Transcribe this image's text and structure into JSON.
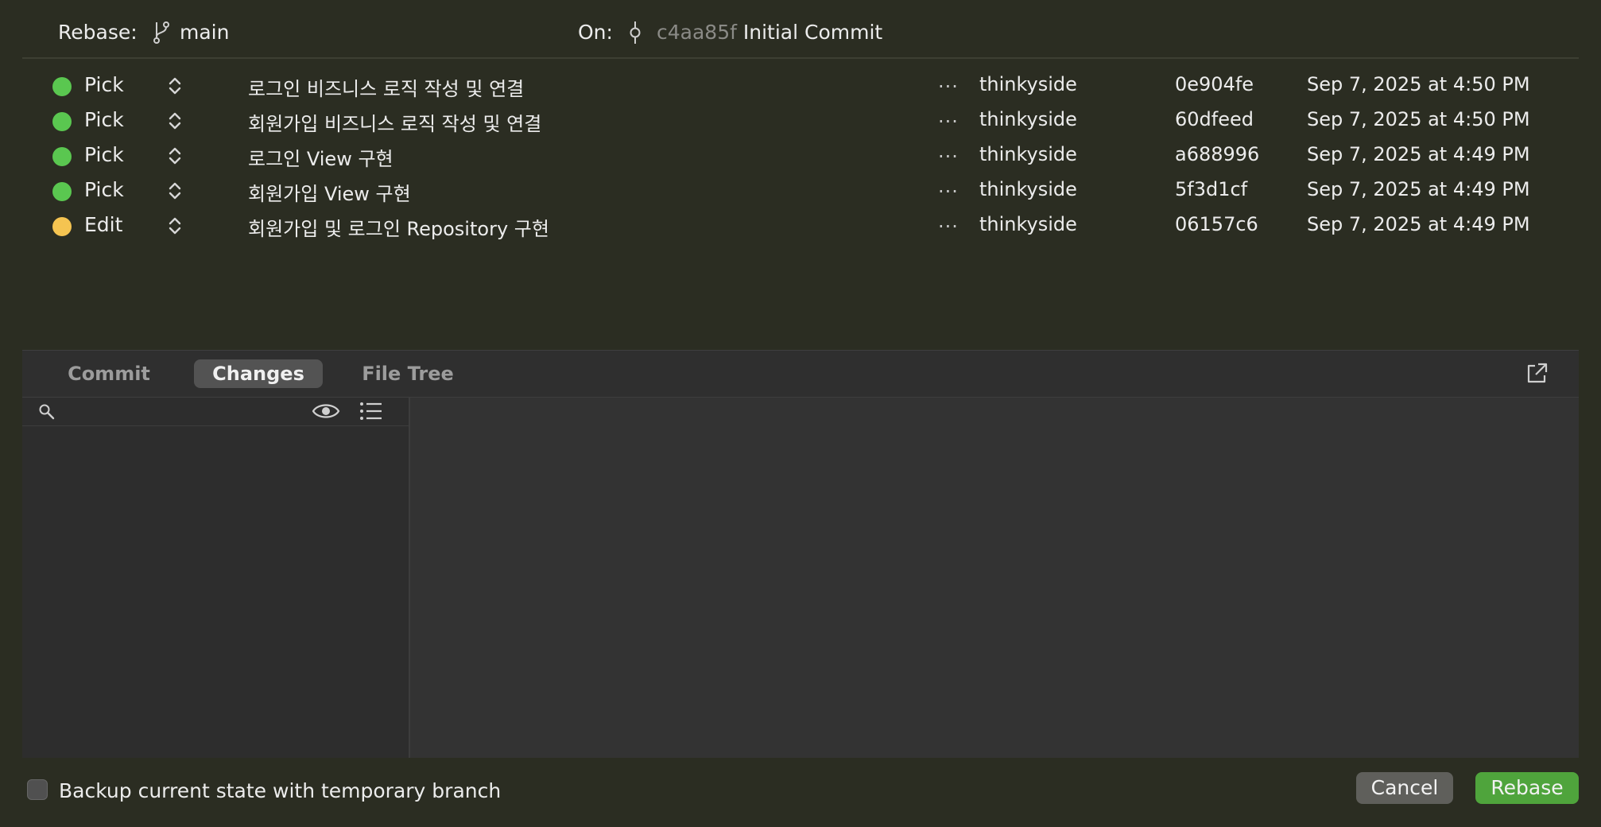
{
  "header": {
    "rebase_label": "Rebase:",
    "branch_icon": "branch-icon",
    "branch_name": "main",
    "on_label": "On:",
    "commit_icon": "commit-icon",
    "onto_hash": "c4aa85f",
    "onto_message": "Initial Commit"
  },
  "rows": [
    {
      "action": "Pick",
      "status_color": "#5ac750",
      "message": "로그인 비즈니스 로직 작성 및 연결",
      "more": "...",
      "author": "thinkyside",
      "hash": "0e904fe",
      "date": "Sep 7, 2025 at 4:50 PM"
    },
    {
      "action": "Pick",
      "status_color": "#5ac750",
      "message": "회원가입 비즈니스 로직 작성 및 연결",
      "more": "...",
      "author": "thinkyside",
      "hash": "60dfeed",
      "date": "Sep 7, 2025 at 4:50 PM"
    },
    {
      "action": "Pick",
      "status_color": "#5ac750",
      "message": "로그인 View 구현",
      "more": "...",
      "author": "thinkyside",
      "hash": "a688996",
      "date": "Sep 7, 2025 at 4:49 PM"
    },
    {
      "action": "Pick",
      "status_color": "#5ac750",
      "message": "회원가입 View 구현",
      "more": "...",
      "author": "thinkyside",
      "hash": "5f3d1cf",
      "date": "Sep 7, 2025 at 4:49 PM"
    },
    {
      "action": "Edit",
      "status_color": "#f5c451",
      "message": "회원가입 및 로그인 Repository 구현",
      "more": "...",
      "author": "thinkyside",
      "hash": "06157c6",
      "date": "Sep 7, 2025 at 4:49 PM"
    }
  ],
  "tabs": [
    {
      "label": "Commit",
      "active": false
    },
    {
      "label": "Changes",
      "active": true
    },
    {
      "label": "File Tree",
      "active": false
    }
  ],
  "filter": {
    "search_placeholder": "",
    "search_icon": "search-icon",
    "eye_icon": "eye-icon",
    "list_icon": "list-icon"
  },
  "footer": {
    "backup_label": "Backup current state with temporary branch",
    "backup_checked": false,
    "cancel_label": "Cancel",
    "rebase_label": "Rebase"
  },
  "colors": {
    "background": "#2b2d22",
    "pick": "#5ac750",
    "edit": "#f5c451",
    "rebase_button": "#4fa43c"
  }
}
